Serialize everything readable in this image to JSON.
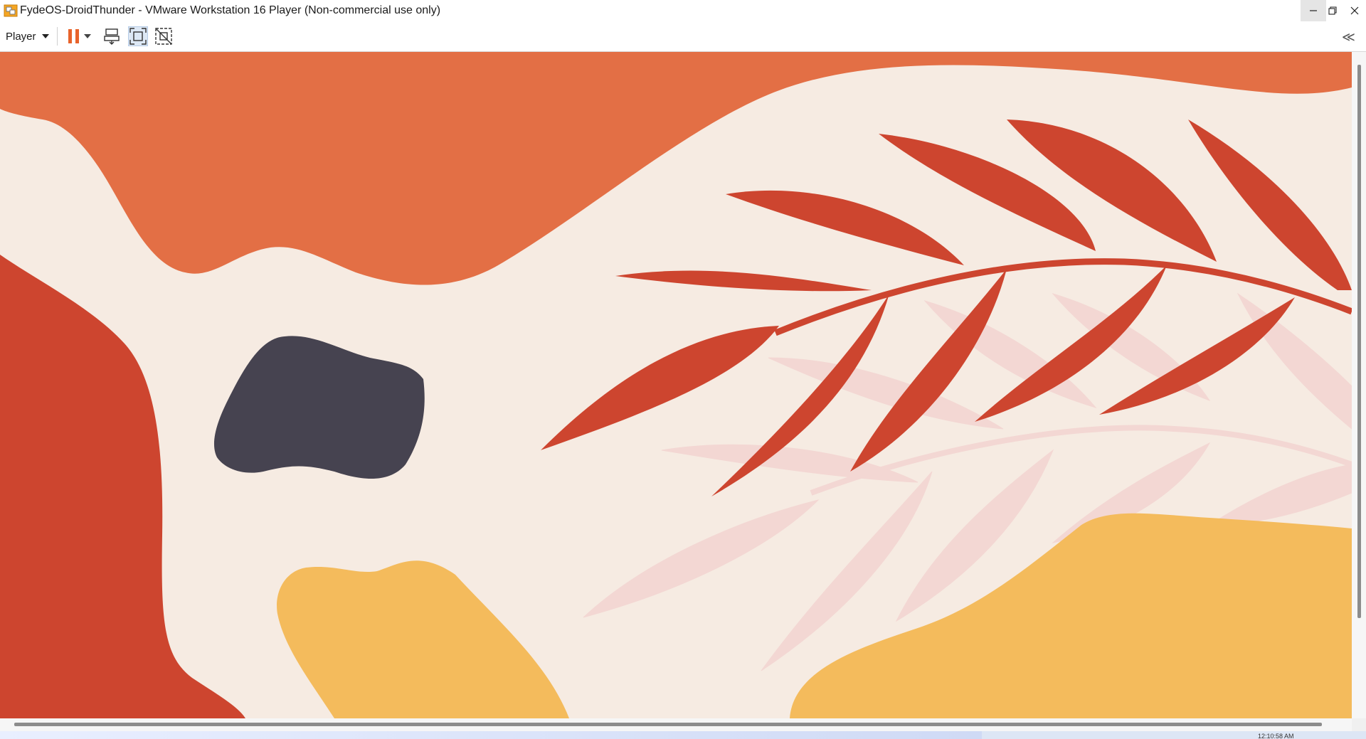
{
  "window": {
    "title": "FydeOS-DroidThunder - VMware Workstation 16 Player (Non-commercial use only)",
    "icon": "vmware-player-icon",
    "controls": [
      "minimize-icon",
      "restore-icon",
      "close-icon"
    ]
  },
  "toolbar": {
    "player_label": "Player",
    "buttons": [
      "pause-icon",
      "dropdown-arrow-icon",
      "send-ctrl-alt-del-icon",
      "fit-guest-icon",
      "unity-icon"
    ],
    "collapse_glyph": "≪",
    "accent_color": "#e8632b"
  },
  "guest_wallpaper": {
    "colors": {
      "background": "#f6ebe2",
      "orange": "#e36f45",
      "red": "#cd452f",
      "yellow": "#f4bb5c",
      "dark": "#464350",
      "faint_leaf": "#f3d7d3"
    }
  },
  "status": {
    "clock_partial": "12:10:58 AM"
  }
}
